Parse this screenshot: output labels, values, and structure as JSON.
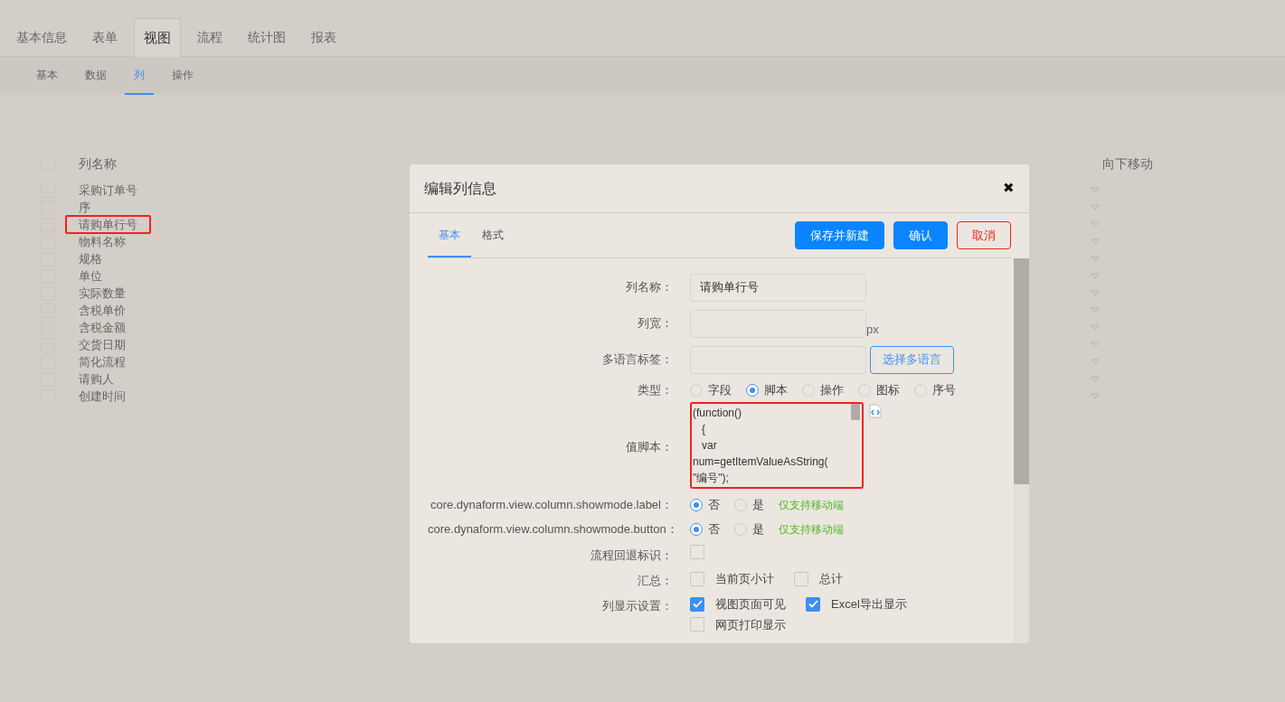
{
  "tabs": [
    {
      "label": "基本信息",
      "selected": false
    },
    {
      "label": "表单",
      "selected": false
    },
    {
      "label": "视图",
      "selected": true
    },
    {
      "label": "流程",
      "selected": false
    },
    {
      "label": "统计图",
      "selected": false
    },
    {
      "label": "报表",
      "selected": false
    }
  ],
  "subtabs": [
    {
      "label": "基本",
      "selected": false
    },
    {
      "label": "数据",
      "selected": false
    },
    {
      "label": "列",
      "selected": true
    },
    {
      "label": "操作",
      "selected": false
    }
  ],
  "table": {
    "header_checked": false,
    "columns": [
      "列名称",
      "向下移动"
    ],
    "rows": [
      {
        "name": "采购订单号",
        "checked": false,
        "highlighted": false
      },
      {
        "name": "序",
        "checked": false,
        "highlighted": false
      },
      {
        "name": "请购单行号",
        "checked": false,
        "highlighted": true
      },
      {
        "name": "物料名称",
        "checked": false,
        "highlighted": false
      },
      {
        "name": "规格",
        "checked": false,
        "highlighted": false
      },
      {
        "name": "单位",
        "checked": false,
        "highlighted": false
      },
      {
        "name": "实际数量",
        "checked": false,
        "highlighted": false
      },
      {
        "name": "含税单价",
        "checked": false,
        "highlighted": false
      },
      {
        "name": "含税金额",
        "checked": false,
        "highlighted": false
      },
      {
        "name": "交货日期",
        "checked": false,
        "highlighted": false
      },
      {
        "name": "简化流程",
        "checked": false,
        "highlighted": false
      },
      {
        "name": "请购人",
        "checked": false,
        "highlighted": false
      },
      {
        "name": "创建时间",
        "checked": false,
        "highlighted": false
      }
    ]
  },
  "dialog": {
    "title": "编辑列信息",
    "close": "✖",
    "tabs": [
      {
        "label": "基本",
        "selected": true
      },
      {
        "label": "格式",
        "selected": false
      }
    ],
    "buttons": [
      {
        "label": "保存并新建",
        "kind": "primary"
      },
      {
        "label": "确认",
        "kind": "primary"
      },
      {
        "label": "取消",
        "kind": "danger"
      }
    ],
    "fields": [
      {
        "kind": "text",
        "label": "列名称：",
        "value": "请购单行号"
      },
      {
        "kind": "text",
        "label": "列宽：",
        "suffix": "px"
      },
      {
        "kind": "text",
        "label": "多语言标签：",
        "button": "选择多语言"
      },
      {
        "kind": "radio",
        "label": "类型：",
        "options": [
          {
            "label": "字段",
            "selected": false
          },
          {
            "label": "脚本",
            "selected": true
          },
          {
            "label": "操作",
            "selected": false
          },
          {
            "label": "图标",
            "selected": false
          },
          {
            "label": "序号",
            "selected": false
          }
        ]
      },
      {
        "kind": "script",
        "label": "值脚本：",
        "value": "(function()\n   {\n   var\nnum=getItemValueAsString(\n\"编号\");",
        "highlighted": true
      },
      {
        "kind": "radio",
        "label": "core.dynaform.view.column.showmode.label：",
        "options": [
          {
            "label": "否",
            "selected": true
          },
          {
            "label": "是",
            "selected": false
          }
        ],
        "note": "仅支持移动端"
      },
      {
        "kind": "radio",
        "label": "core.dynaform.view.column.showmode.button：",
        "options": [
          {
            "label": "否",
            "selected": true
          },
          {
            "label": "是",
            "selected": false
          }
        ],
        "note": "仅支持移动端"
      },
      {
        "kind": "checks",
        "label": "流程回退标识：",
        "options": [
          {
            "checked": false
          }
        ]
      },
      {
        "kind": "checks",
        "label": "汇总：",
        "options": [
          {
            "label": "当前页小计",
            "checked": false
          },
          {
            "label": "总计",
            "checked": false
          }
        ]
      },
      {
        "kind": "checks",
        "label": "列显示设置：",
        "options": [
          {
            "label": "视图页面可见",
            "checked": true
          },
          {
            "label": "Excel导出显示",
            "checked": true
          },
          {
            "label": "网页打印显示",
            "checked": false
          }
        ]
      }
    ]
  }
}
